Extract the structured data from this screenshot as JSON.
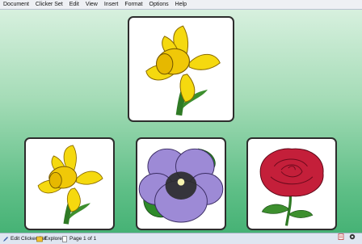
{
  "menu": [
    "Document",
    "Clicker Set",
    "Edit",
    "View",
    "Insert",
    "Format",
    "Options",
    "Help"
  ],
  "cards": [
    {
      "name": "daffodil-large-card",
      "icon": "daffodil-image"
    },
    {
      "name": "daffodil-card",
      "icon": "daffodil-image"
    },
    {
      "name": "pansy-card",
      "icon": "pansy-image"
    },
    {
      "name": "rose-card",
      "icon": "rose-image"
    }
  ],
  "status": {
    "edit_clicker_set": "Edit Clicker Set",
    "explorer": "Explorer",
    "page": "Page 1 of 1"
  }
}
